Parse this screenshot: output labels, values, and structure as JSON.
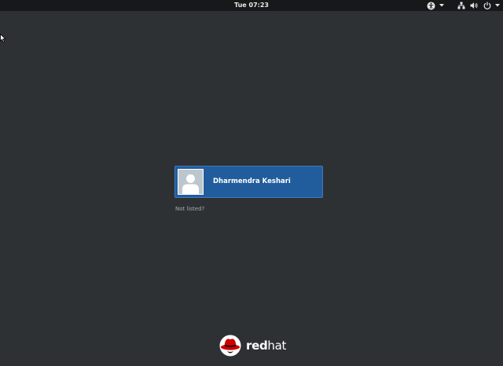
{
  "topbar": {
    "clock": "Tue 07:23",
    "icons": {
      "accessibility": "accessibility-icon",
      "accessibility_menu": "dropdown-arrow-icon",
      "network": "network-wired-icon",
      "volume": "volume-icon",
      "power": "power-icon",
      "status_menu": "dropdown-arrow-icon"
    }
  },
  "login": {
    "user": {
      "name": "Dharmendra Keshari",
      "avatar_icon": "user-avatar-icon"
    },
    "not_listed": "Not listed?"
  },
  "branding": {
    "logo_icon": "redhat-logo-icon",
    "logo_text_bold": "red",
    "logo_text_regular": "hat"
  },
  "colors": {
    "background": "#2e3134",
    "topbar": "#16181a",
    "selected_user": "#215d9c",
    "brand_red": "#cc0000"
  }
}
